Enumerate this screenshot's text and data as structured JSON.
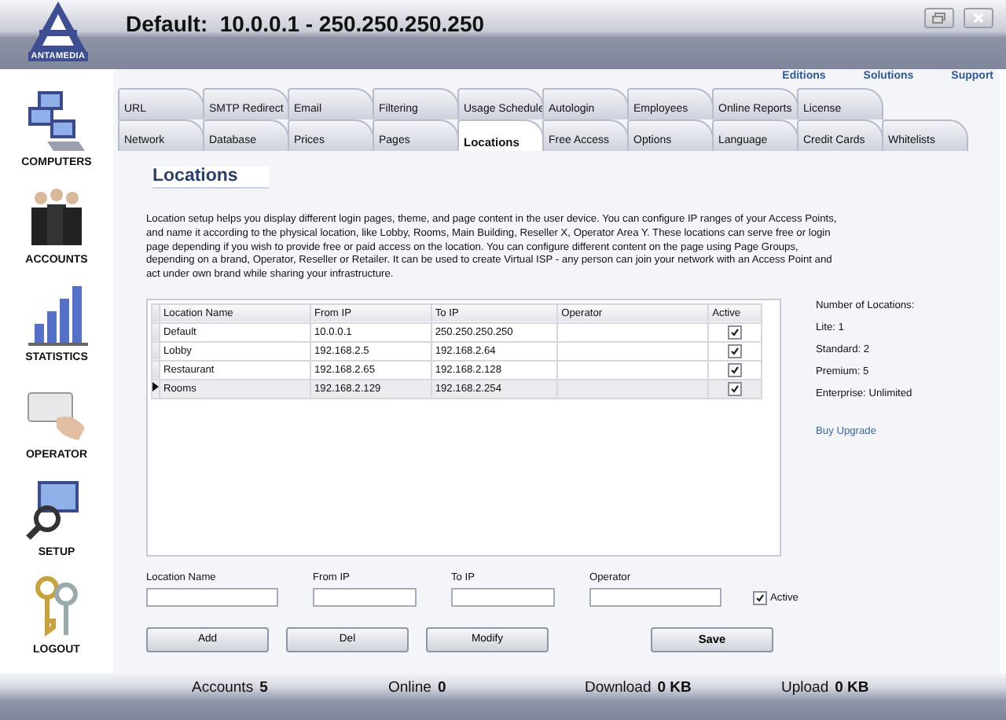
{
  "window": {
    "title": "Default:  10.0.0.1 - 250.250.250.250",
    "logo": "ANTAMEDIA"
  },
  "sidebar": {
    "items": [
      {
        "label": "COMPUTERS",
        "kind": "computers"
      },
      {
        "label": "ACCOUNTS",
        "kind": "people"
      },
      {
        "label": "STATISTICS",
        "kind": "chart"
      },
      {
        "label": "OPERATOR",
        "kind": "card"
      },
      {
        "label": "SETUP",
        "kind": "setup"
      },
      {
        "label": "LOGOUT",
        "kind": "keys"
      }
    ]
  },
  "top_links": [
    "Editions",
    "Solutions",
    "Support"
  ],
  "tabs": {
    "rows": [
      [
        {
          "label": "URL",
          "selected": false
        },
        {
          "label": "SMTP Redirect",
          "selected": false
        },
        {
          "label": "Email",
          "selected": false
        },
        {
          "label": "Filtering",
          "selected": false
        },
        {
          "label": "Usage Schedule",
          "selected": false
        },
        {
          "label": "Autologin",
          "selected": false
        },
        {
          "label": "Employees",
          "selected": false
        },
        {
          "label": "Online Reports",
          "selected": false
        },
        {
          "label": "License",
          "selected": false
        }
      ],
      [
        {
          "label": "Network",
          "selected": false
        },
        {
          "label": "Database",
          "selected": false
        },
        {
          "label": "Prices",
          "selected": false
        },
        {
          "label": "Pages",
          "selected": false
        },
        {
          "label": "Locations",
          "selected": true
        },
        {
          "label": "Free Access",
          "selected": false
        },
        {
          "label": "Options",
          "selected": false
        },
        {
          "label": "Language",
          "selected": false
        },
        {
          "label": "Credit Cards",
          "selected": false
        },
        {
          "label": "Whitelists",
          "selected": false
        }
      ]
    ]
  },
  "heading": "Locations",
  "description": "Location setup helps you display different login pages, theme, and page content in the user device. You can configure IP ranges of your Access Points, and name it according to the physical location, like Lobby, Rooms, Main Building, Reseller X, Operator Area Y. These locations can serve free or login page depending if you wish to provide free or paid access on the location. You can configure different content on the page using Page Groups, depending on a brand, Operator, Reseller or Retailer. It can be used to create Virtual ISP - any person can join your network with an Access Point and act under own brand while sharing your infrastructure.",
  "table": {
    "columns": [
      "Location Name",
      "From IP",
      "To IP",
      "Operator",
      "Active"
    ],
    "rows": [
      {
        "cells": [
          "Default",
          "10.0.0.1",
          "250.250.250.250",
          ""
        ],
        "active": true,
        "selected": false
      },
      {
        "cells": [
          "Lobby",
          "192.168.2.5",
          "192.168.2.64",
          ""
        ],
        "active": true,
        "selected": false
      },
      {
        "cells": [
          "Restaurant",
          "192.168.2.65",
          "192.168.2.128",
          ""
        ],
        "active": true,
        "selected": false
      },
      {
        "cells": [
          "Rooms",
          "192.168.2.129",
          "192.168.2.254",
          ""
        ],
        "active": true,
        "selected": true
      }
    ]
  },
  "summary": {
    "title": "Number of Locations:",
    "lines": [
      "Lite: 1",
      "Standard: 2",
      "Premium: 5",
      "Enterprise: Unlimited"
    ],
    "link": "Buy Upgrade"
  },
  "form": {
    "fields": [
      {
        "label": "Location Name"
      },
      {
        "label": "From IP"
      },
      {
        "label": "To IP"
      },
      {
        "label": "Operator"
      }
    ],
    "active": {
      "label": "Active",
      "checked": true
    }
  },
  "buttons": [
    {
      "label": "Add",
      "kind": "normal"
    },
    {
      "label": "Del",
      "kind": "normal"
    },
    {
      "label": "Modify",
      "kind": "normal"
    },
    {
      "label": "Save",
      "kind": "primary"
    }
  ],
  "status_bar": [
    {
      "label": "Accounts",
      "value": "5"
    },
    {
      "label": "Online",
      "value": "0"
    },
    {
      "label": "Download",
      "value": "0 KB"
    },
    {
      "label": "Upload",
      "value": "0 KB"
    }
  ]
}
